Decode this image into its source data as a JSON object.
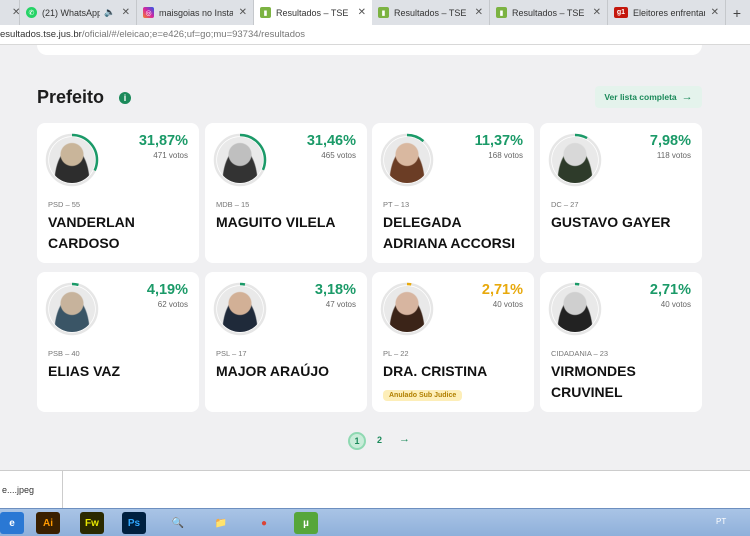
{
  "browser": {
    "tabs": [
      {
        "title": "",
        "favicon": "",
        "color": "#ffffff",
        "active": false
      },
      {
        "title": "(21) WhatsApp",
        "favicon": "whatsapp-icon",
        "color": "#25d366",
        "active": false,
        "muted": true
      },
      {
        "title": "maisgoias no Instag",
        "favicon": "instagram-icon",
        "color": "#d6249f",
        "active": false
      },
      {
        "title": "Resultados – TSE",
        "favicon": "tse-icon",
        "color": "#7cb342",
        "active": true
      },
      {
        "title": "Resultados – TSE",
        "favicon": "tse-icon",
        "color": "#7cb342",
        "active": false
      },
      {
        "title": "Resultados – TSE",
        "favicon": "tse-icon",
        "color": "#7cb342",
        "active": false
      },
      {
        "title": "Eleitores enfrentam",
        "favicon": "g1-icon",
        "color": "#c4170c",
        "active": false
      }
    ],
    "url_host": "esultados.tse.jus.br",
    "url_path": "/oficial/#/eleicao;e=e426;uf=go;mu=93734/resultados"
  },
  "section": {
    "title": "Prefeito",
    "view_full_list": "Ver lista completa"
  },
  "candidates": [
    {
      "pct": "31,87%",
      "votes": "471 votos",
      "party": "PSD – 55",
      "name": "VANDERLAN CARDOSO",
      "pct_value": 31.87,
      "accent": "#1b9a68"
    },
    {
      "pct": "31,46%",
      "votes": "465 votos",
      "party": "MDB – 15",
      "name": "MAGUITO VILELA",
      "pct_value": 31.46,
      "accent": "#1b9a68"
    },
    {
      "pct": "11,37%",
      "votes": "168 votos",
      "party": "PT – 13",
      "name": "DELEGADA ADRIANA ACCORSI",
      "pct_value": 11.37,
      "accent": "#1b9a68"
    },
    {
      "pct": "7,98%",
      "votes": "118 votos",
      "party": "DC – 27",
      "name": "GUSTAVO GAYER",
      "pct_value": 7.98,
      "accent": "#1b9a68"
    },
    {
      "pct": "4,19%",
      "votes": "62 votos",
      "party": "PSB – 40",
      "name": "ELIAS VAZ",
      "pct_value": 4.19,
      "accent": "#1b9a68"
    },
    {
      "pct": "3,18%",
      "votes": "47 votos",
      "party": "PSL – 17",
      "name": "MAJOR ARAÚJO",
      "pct_value": 3.18,
      "accent": "#1b9a68"
    },
    {
      "pct": "2,71%",
      "votes": "40 votos",
      "party": "PL – 22",
      "name": "DRA. CRISTINA",
      "pct_value": 2.71,
      "accent": "#e8a90c",
      "badge": "Anulado Sub Judice"
    },
    {
      "pct": "2,71%",
      "votes": "40 votos",
      "party": "CIDADANIA – 23",
      "name": "VIRMONDES CRUVINEL",
      "pct_value": 2.71,
      "accent": "#1b9a68"
    }
  ],
  "pagination": {
    "page1": "1",
    "page2": "2",
    "next": "→"
  },
  "downloads": {
    "file": "e....jpeg"
  },
  "taskbar": {
    "lang": "PT",
    "apps": [
      {
        "name": "ie-icon",
        "label": "e",
        "bg": "#2a78d4",
        "fg": "#ffffff"
      },
      {
        "name": "illustrator-icon",
        "label": "Ai",
        "bg": "#3a2000",
        "fg": "#ff9a00"
      },
      {
        "name": "fireworks-icon",
        "label": "Fw",
        "bg": "#2b2a00",
        "fg": "#e6e600"
      },
      {
        "name": "photoshop-icon",
        "label": "Ps",
        "bg": "#00203f",
        "fg": "#31a8ff"
      },
      {
        "name": "search-document-icon",
        "label": "🔍",
        "bg": "transparent",
        "fg": "#333333"
      },
      {
        "name": "folder-icon",
        "label": "📁",
        "bg": "transparent",
        "fg": "#e7b84a"
      },
      {
        "name": "chrome-icon",
        "label": "●",
        "bg": "transparent",
        "fg": "#db4437"
      },
      {
        "name": "utorrent-icon",
        "label": "µ",
        "bg": "#56a63a",
        "fg": "#ffffff"
      }
    ]
  }
}
